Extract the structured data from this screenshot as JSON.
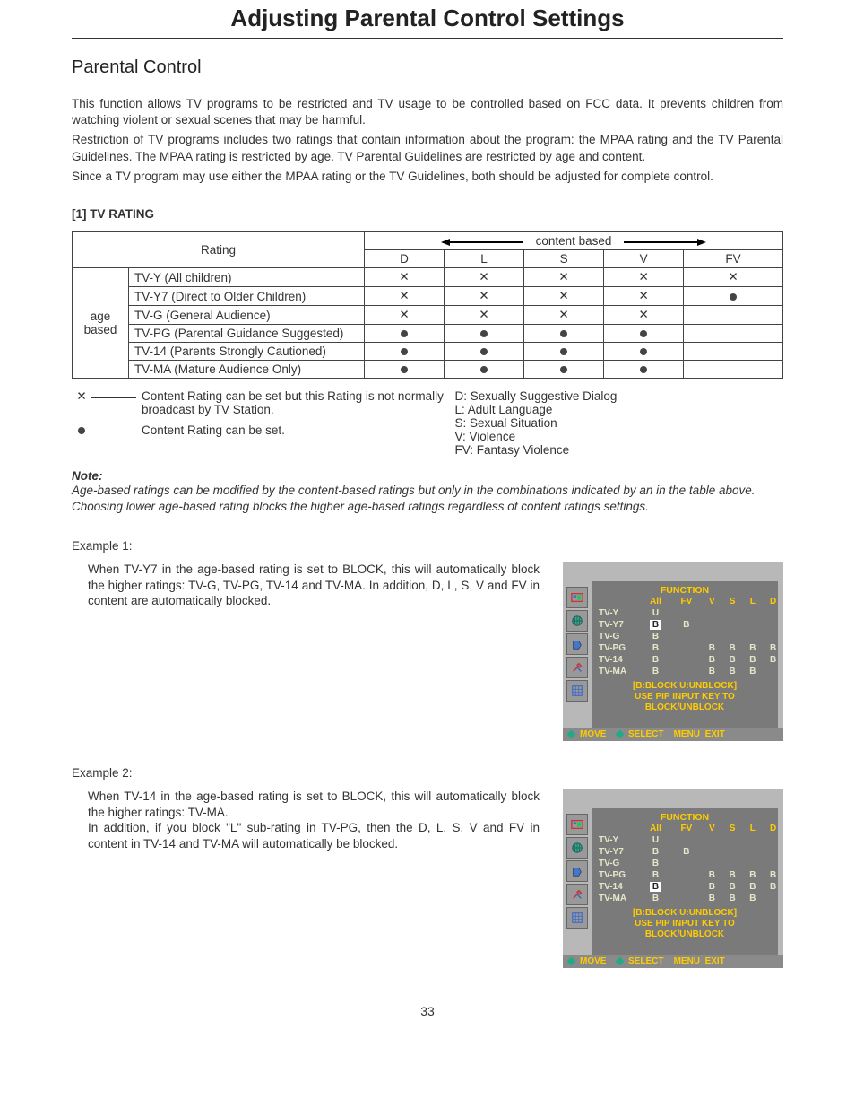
{
  "title": "Adjusting Parental Control Settings",
  "section_title": "Parental Control",
  "intro": {
    "p1": "This function allows TV programs to be restricted and TV usage to be controlled based on FCC data. It prevents children from watching violent or sexual scenes that may be harmful.",
    "p2": "Restriction of TV programs includes two ratings that contain information about the program: the MPAA rating and the TV Parental Guidelines. The MPAA rating is restricted by age. TV Parental Guidelines are restricted by age and content.",
    "p3": "Since a TV program may use either the MPAA rating or the TV Guidelines, both should be adjusted for complete control."
  },
  "tv_rating_head": "[1] TV RATING",
  "chart_data": {
    "type": "table",
    "row_header": "Rating",
    "col_header": "content based",
    "age_based_label": "age\nbased",
    "columns": [
      "D",
      "L",
      "S",
      "V",
      "FV"
    ],
    "rows": [
      {
        "label": "TV-Y (All children)",
        "cells": [
          "x",
          "x",
          "x",
          "x",
          "x"
        ]
      },
      {
        "label": "TV-Y7 (Direct to Older Children)",
        "cells": [
          "x",
          "x",
          "x",
          "x",
          "dot"
        ]
      },
      {
        "label": "TV-G (General Audience)",
        "cells": [
          "x",
          "x",
          "x",
          "x",
          ""
        ]
      },
      {
        "label": "TV-PG (Parental Guidance Suggested)",
        "cells": [
          "dot",
          "dot",
          "dot",
          "dot",
          ""
        ]
      },
      {
        "label": "TV-14 (Parents Strongly Cautioned)",
        "cells": [
          "dot",
          "dot",
          "dot",
          "dot",
          ""
        ]
      },
      {
        "label": "TV-MA (Mature Audience Only)",
        "cells": [
          "dot",
          "dot",
          "dot",
          "dot",
          ""
        ]
      }
    ]
  },
  "legend": {
    "x_text": "Content Rating can be set but this Rating is not normally broadcast by TV Station.",
    "dot_text": "Content Rating can be set.",
    "codes": {
      "d": "D: Sexually Suggestive Dialog",
      "l": "L: Adult  Language",
      "s": "S: Sexual Situation",
      "v": "V: Violence",
      "fv": "FV: Fantasy Violence"
    }
  },
  "note": {
    "head": "Note:",
    "body1": "Age-based ratings can be modified by the content-based ratings but only in the combinations indicated by an     in the table above.",
    "body2": "Choosing lower age-based rating blocks the higher age-based ratings regardless of content ratings settings."
  },
  "example1": {
    "label": "Example 1:",
    "text": "When TV-Y7 in the age-based rating is set to BLOCK, this will automatically block the higher ratings: TV-G, TV-PG, TV-14 and TV-MA. In addition, D, L, S, V and FV in content are automatically blocked."
  },
  "example2": {
    "label": "Example 2:",
    "text1": "When TV-14 in the age-based rating is set to BLOCK, this will automatically block the higher ratings: TV-MA.",
    "text2": "In addition, if you block \"L\" sub-rating in TV-PG, then the D, L, S, V and FV in content in TV-14 and TV-MA will automatically be blocked."
  },
  "osd": {
    "title": "FUNCTION",
    "headers": [
      "All",
      "FV",
      "V",
      "S",
      "L",
      "D"
    ],
    "ex1_rows": [
      {
        "lbl": "TV-Y",
        "cells": [
          "U",
          "",
          "",
          "",
          "",
          ""
        ],
        "hi": -1
      },
      {
        "lbl": "TV-Y7",
        "cells": [
          "B",
          "B",
          "",
          "",
          "",
          ""
        ],
        "hi": 0
      },
      {
        "lbl": "TV-G",
        "cells": [
          "B",
          "",
          "",
          "",
          "",
          ""
        ],
        "hi": -1
      },
      {
        "lbl": "TV-PG",
        "cells": [
          "B",
          "",
          "B",
          "B",
          "B",
          "B"
        ],
        "hi": -1
      },
      {
        "lbl": "TV-14",
        "cells": [
          "B",
          "",
          "B",
          "B",
          "B",
          "B"
        ],
        "hi": -1
      },
      {
        "lbl": "TV-MA",
        "cells": [
          "B",
          "",
          "B",
          "B",
          "B",
          ""
        ],
        "hi": -1
      }
    ],
    "ex2_rows": [
      {
        "lbl": "TV-Y",
        "cells": [
          "U",
          "",
          "",
          "",
          "",
          ""
        ],
        "hi": -1
      },
      {
        "lbl": "TV-Y7",
        "cells": [
          "B",
          "B",
          "",
          "",
          "",
          ""
        ],
        "hi": -1
      },
      {
        "lbl": "TV-G",
        "cells": [
          "B",
          "",
          "",
          "",
          "",
          ""
        ],
        "hi": -1
      },
      {
        "lbl": "TV-PG",
        "cells": [
          "B",
          "",
          "B",
          "B",
          "B",
          "B"
        ],
        "hi": -1
      },
      {
        "lbl": "TV-14",
        "cells": [
          "B",
          "",
          "B",
          "B",
          "B",
          "B"
        ],
        "hi": 0
      },
      {
        "lbl": "TV-MA",
        "cells": [
          "B",
          "",
          "B",
          "B",
          "B",
          ""
        ],
        "hi": -1
      }
    ],
    "msg1": "[B:BLOCK        U:UNBLOCK]",
    "msg2": "USE  PIP INPUT  KEY  TO",
    "msg3": "BLOCK/UNBLOCK",
    "footer": {
      "move": "MOVE",
      "select": "SELECT",
      "menu": "MENU",
      "exit": "EXIT"
    }
  },
  "page_number": "33"
}
